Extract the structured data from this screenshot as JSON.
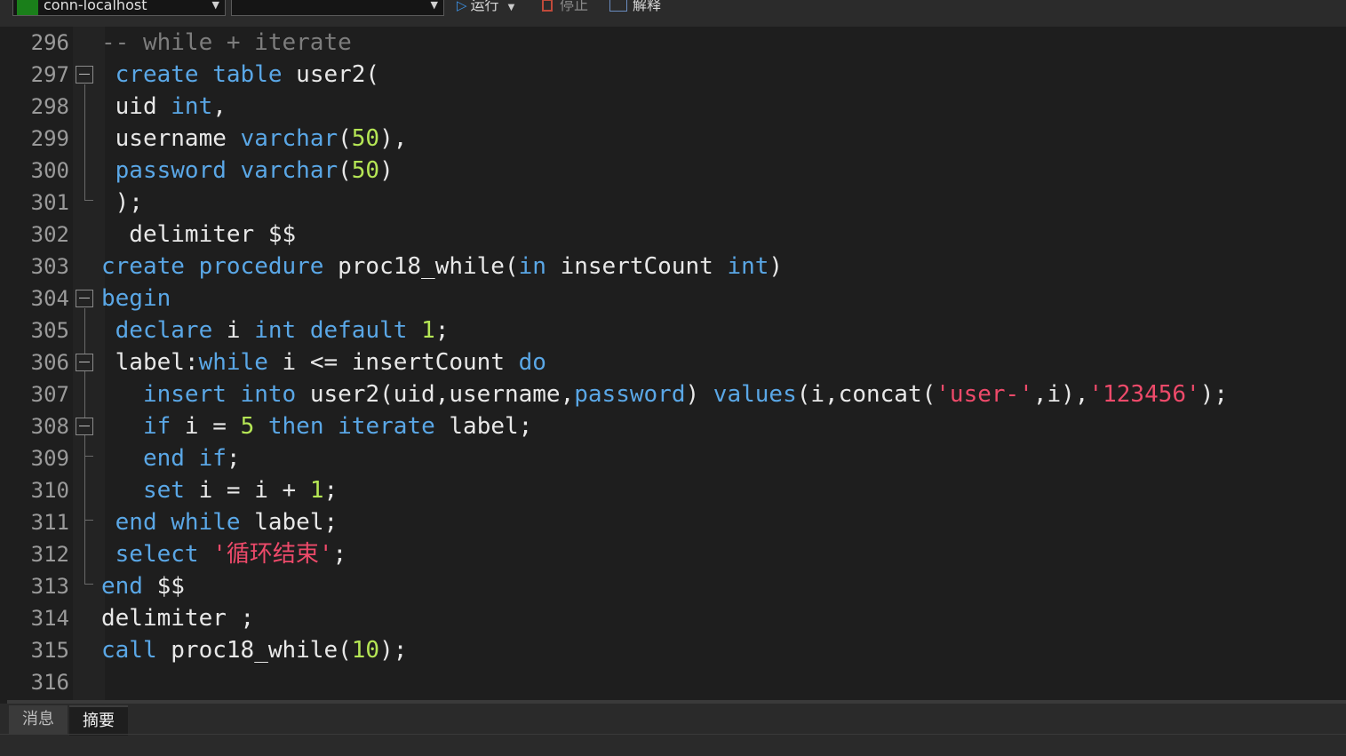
{
  "toolbar": {
    "connection": "conn-localhost",
    "database": "",
    "run_label": "运行",
    "stop_label": "停止",
    "explain_label": "解释"
  },
  "editor": {
    "lines": [
      {
        "num": "296",
        "tokens": [
          {
            "t": "-- while + iterate",
            "c": "cm"
          }
        ]
      },
      {
        "num": "297",
        "tokens": [
          {
            "t": " "
          },
          {
            "t": "create",
            "c": "kw"
          },
          {
            "t": " "
          },
          {
            "t": "table",
            "c": "kw"
          },
          {
            "t": " user2("
          }
        ]
      },
      {
        "num": "298",
        "tokens": [
          {
            "t": " uid "
          },
          {
            "t": "int",
            "c": "kw"
          },
          {
            "t": ","
          }
        ]
      },
      {
        "num": "299",
        "tokens": [
          {
            "t": " username "
          },
          {
            "t": "varchar",
            "c": "kw"
          },
          {
            "t": "("
          },
          {
            "t": "50",
            "c": "num"
          },
          {
            "t": "),"
          }
        ]
      },
      {
        "num": "300",
        "tokens": [
          {
            "t": " "
          },
          {
            "t": "password",
            "c": "kw"
          },
          {
            "t": " "
          },
          {
            "t": "varchar",
            "c": "kw"
          },
          {
            "t": "("
          },
          {
            "t": "50",
            "c": "num"
          },
          {
            "t": ")"
          }
        ]
      },
      {
        "num": "301",
        "tokens": [
          {
            "t": " );"
          }
        ]
      },
      {
        "num": "302",
        "tokens": [
          {
            "t": "  delimiter $$"
          }
        ]
      },
      {
        "num": "303",
        "tokens": [
          {
            "t": "create",
            "c": "kw"
          },
          {
            "t": " "
          },
          {
            "t": "procedure",
            "c": "kw"
          },
          {
            "t": " proc18_while("
          },
          {
            "t": "in",
            "c": "kw"
          },
          {
            "t": " insertCount "
          },
          {
            "t": "int",
            "c": "kw"
          },
          {
            "t": ")"
          }
        ]
      },
      {
        "num": "304",
        "tokens": [
          {
            "t": "begin",
            "c": "kw"
          }
        ]
      },
      {
        "num": "305",
        "tokens": [
          {
            "t": " "
          },
          {
            "t": "declare",
            "c": "kw"
          },
          {
            "t": " i "
          },
          {
            "t": "int",
            "c": "kw"
          },
          {
            "t": " "
          },
          {
            "t": "default",
            "c": "kw"
          },
          {
            "t": " "
          },
          {
            "t": "1",
            "c": "num"
          },
          {
            "t": ";"
          }
        ]
      },
      {
        "num": "306",
        "tokens": [
          {
            "t": " label:"
          },
          {
            "t": "while",
            "c": "kw"
          },
          {
            "t": " i <= insertCount "
          },
          {
            "t": "do",
            "c": "kw"
          }
        ]
      },
      {
        "num": "307",
        "tokens": [
          {
            "t": "   "
          },
          {
            "t": "insert",
            "c": "kw"
          },
          {
            "t": " "
          },
          {
            "t": "into",
            "c": "kw"
          },
          {
            "t": " user2(uid,username,"
          },
          {
            "t": "password",
            "c": "kw"
          },
          {
            "t": ") "
          },
          {
            "t": "values",
            "c": "kw"
          },
          {
            "t": "(i,concat("
          },
          {
            "t": "'user-'",
            "c": "str"
          },
          {
            "t": ",i),"
          },
          {
            "t": "'123456'",
            "c": "str"
          },
          {
            "t": ");"
          }
        ]
      },
      {
        "num": "308",
        "tokens": [
          {
            "t": "   "
          },
          {
            "t": "if",
            "c": "kw"
          },
          {
            "t": " i = "
          },
          {
            "t": "5",
            "c": "num"
          },
          {
            "t": " "
          },
          {
            "t": "then",
            "c": "kw"
          },
          {
            "t": " "
          },
          {
            "t": "iterate",
            "c": "kw"
          },
          {
            "t": " label;"
          }
        ]
      },
      {
        "num": "309",
        "tokens": [
          {
            "t": "   "
          },
          {
            "t": "end",
            "c": "kw"
          },
          {
            "t": " "
          },
          {
            "t": "if",
            "c": "kw"
          },
          {
            "t": ";"
          }
        ]
      },
      {
        "num": "310",
        "tokens": [
          {
            "t": "   "
          },
          {
            "t": "set",
            "c": "kw"
          },
          {
            "t": " i = i + "
          },
          {
            "t": "1",
            "c": "num"
          },
          {
            "t": ";"
          }
        ]
      },
      {
        "num": "311",
        "tokens": [
          {
            "t": " "
          },
          {
            "t": "end",
            "c": "kw"
          },
          {
            "t": " "
          },
          {
            "t": "while",
            "c": "kw"
          },
          {
            "t": " label;"
          }
        ]
      },
      {
        "num": "312",
        "tokens": [
          {
            "t": " "
          },
          {
            "t": "select",
            "c": "kw"
          },
          {
            "t": " "
          },
          {
            "t": "'循环结束'",
            "c": "str"
          },
          {
            "t": ";"
          }
        ]
      },
      {
        "num": "313",
        "tokens": [
          {
            "t": "end",
            "c": "kw"
          },
          {
            "t": " $$"
          }
        ]
      },
      {
        "num": "314",
        "tokens": [
          {
            "t": "delimiter ;"
          }
        ]
      },
      {
        "num": "315",
        "tokens": [
          {
            "t": "call",
            "c": "kw"
          },
          {
            "t": " proc18_while("
          },
          {
            "t": "10",
            "c": "num"
          },
          {
            "t": ");"
          }
        ]
      },
      {
        "num": "316",
        "tokens": []
      }
    ]
  },
  "bottom_tabs": {
    "messages": "消息",
    "summary": "摘要"
  },
  "colors": {
    "keyword": "#5aa7e6",
    "number": "#b5e655",
    "string": "#ee4a6a",
    "comment": "#7d7d7d",
    "text": "#e8e8e8",
    "background": "#1e1e1e"
  }
}
